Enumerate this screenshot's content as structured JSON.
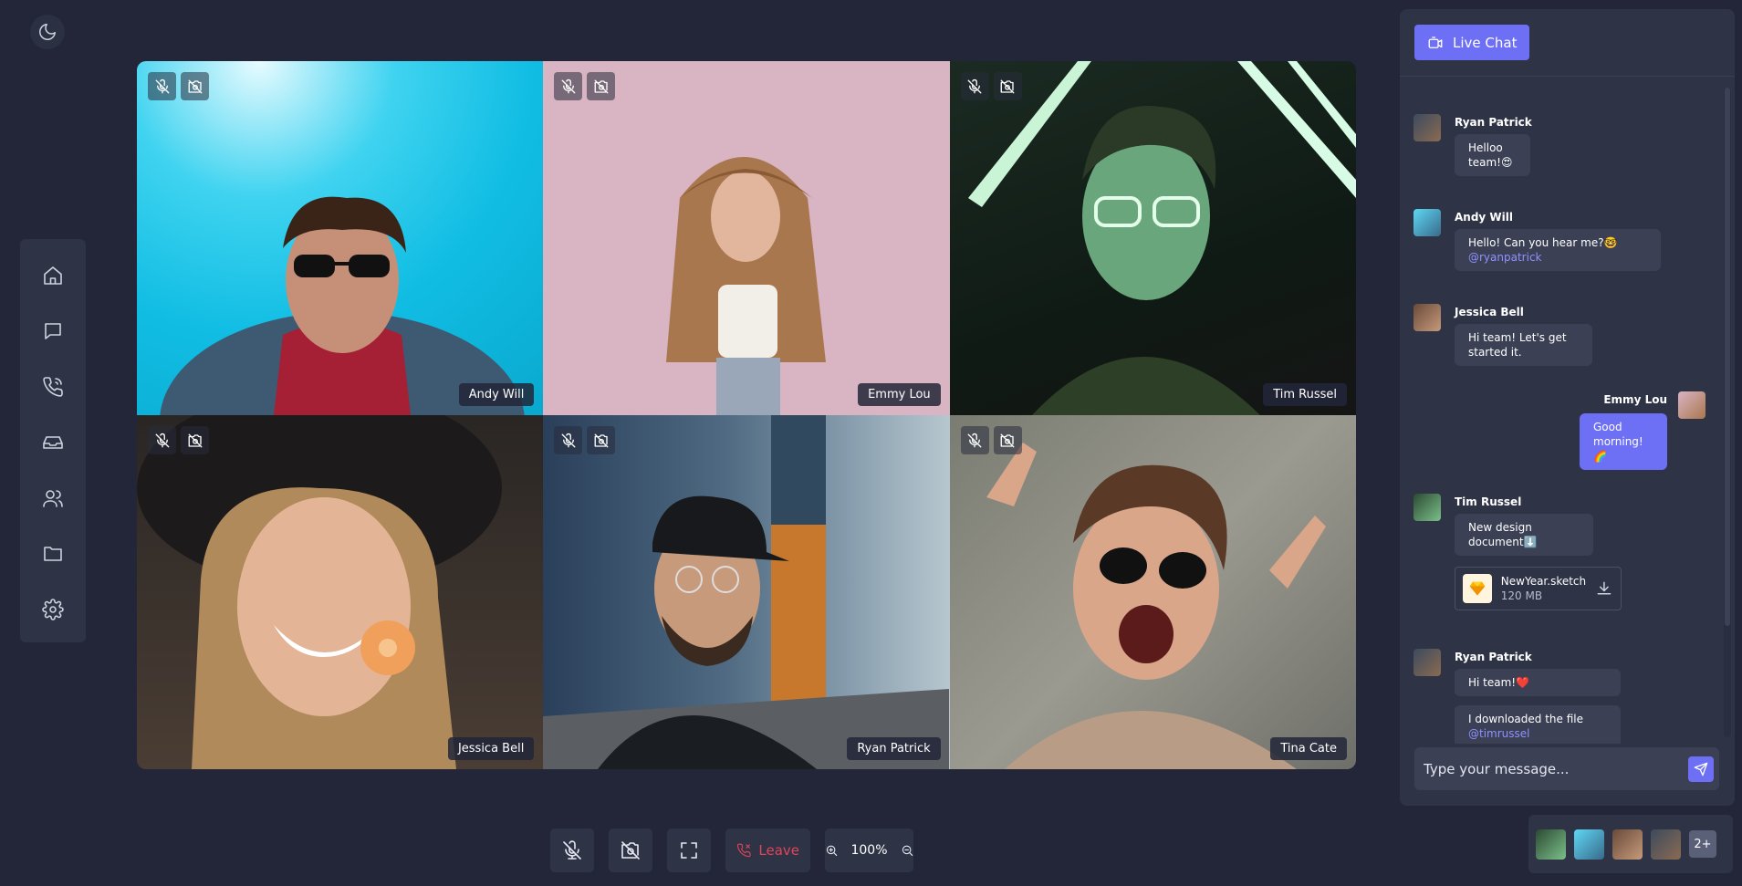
{
  "colors": {
    "accent": "#6d6ff5",
    "leave": "#e0455a",
    "background": "#222638",
    "panel": "#2e3346"
  },
  "icons": {
    "theme": "moon-icon",
    "nav": [
      "home-icon",
      "chat-icon",
      "phone-call-icon",
      "inbox-icon",
      "users-icon",
      "folder-icon",
      "gear-icon"
    ],
    "tile_state": [
      "mic-off-icon",
      "camera-off-icon"
    ]
  },
  "participants_grid": [
    {
      "name": "Andy Will"
    },
    {
      "name": "Emmy Lou"
    },
    {
      "name": "Tim Russel"
    },
    {
      "name": "Jessica Bell"
    },
    {
      "name": "Ryan Patrick"
    },
    {
      "name": "Tina Cate"
    }
  ],
  "controls": {
    "leave_label": "Leave",
    "zoom_level": "100%"
  },
  "chat": {
    "tab_label": "Live Chat",
    "messages": [
      {
        "sender": "Ryan Patrick",
        "line1": "Helloo",
        "line2": "team!😍"
      },
      {
        "sender": "Andy Will",
        "line1": "Hello! Can you hear me?🤓",
        "mention": "@ryanpatrick"
      },
      {
        "sender": "Jessica Bell",
        "line1": "Hi team! Let's get",
        "line2": "started it."
      },
      {
        "sender": "Emmy Lou",
        "line1": "Good",
        "line2": "morning!🌈"
      },
      {
        "sender": "Tim Russel",
        "line1": "New design",
        "line2": "document⬇️"
      },
      {
        "sender": "Ryan Patrick",
        "line1": "Hi team!❤️",
        "line2": "I downloaded the file",
        "mention": "@timrussel"
      }
    ],
    "file": {
      "name": "NewYear.sketch",
      "size": "120 MB"
    },
    "input_placeholder": "Type your message..."
  },
  "participants_strip": {
    "more_label": "2+"
  }
}
